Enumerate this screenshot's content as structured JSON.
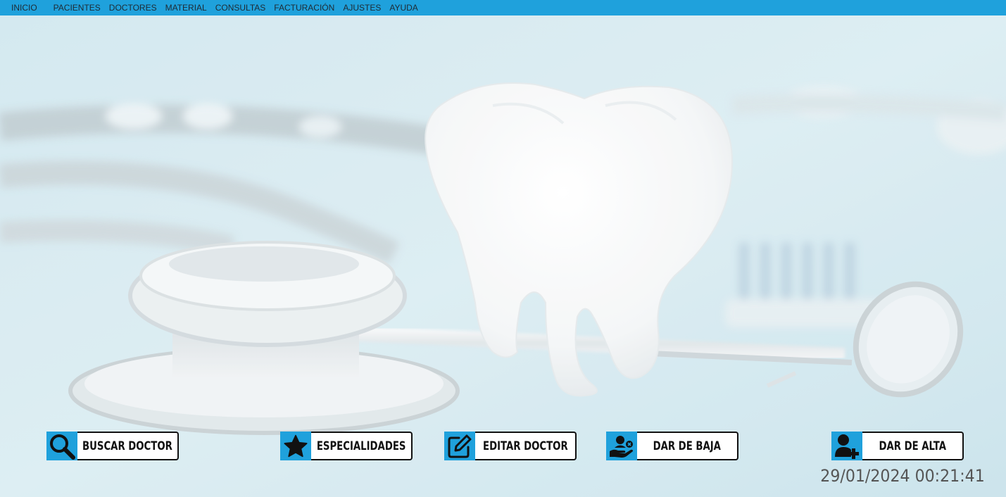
{
  "menu": {
    "items": [
      "INICIO",
      "PACIENTES",
      "DOCTORES",
      "MATERIAL",
      "CONSULTAS",
      "FACTURACIÓN",
      "AJUSTES",
      "AYUDA"
    ]
  },
  "actions": {
    "buscar": {
      "label": "BUSCAR DOCTOR",
      "icon": "search-icon"
    },
    "especialidades": {
      "label": "ESPECIALIDADES",
      "icon": "star-icon"
    },
    "editar": {
      "label": "EDITAR DOCTOR",
      "icon": "edit-icon"
    },
    "baja": {
      "label": "DAR DE BAJA",
      "icon": "remove-user-icon"
    },
    "alta": {
      "label": "DAR DE ALTA",
      "icon": "add-user-icon"
    }
  },
  "status": {
    "datetime": "29/01/2024 00:21:41"
  },
  "colors": {
    "accent": "#1fa1dc",
    "text": "#111111",
    "background": "#cfe5ee"
  }
}
